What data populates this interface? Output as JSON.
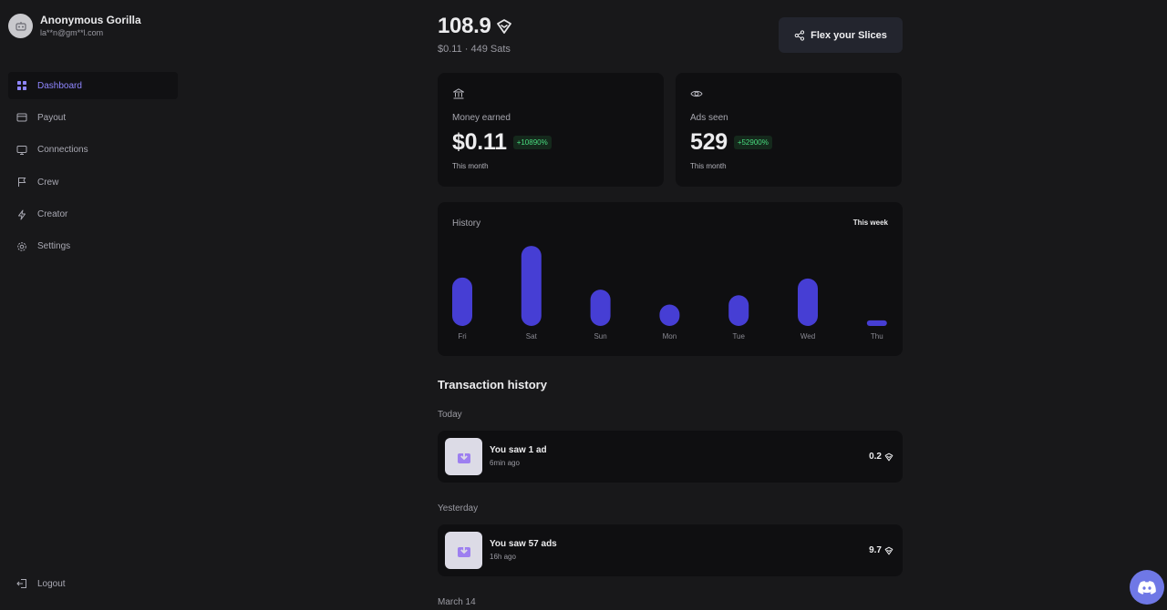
{
  "user": {
    "name": "Anonymous Gorilla",
    "email": "la**n@gm**l.com"
  },
  "nav": {
    "items": [
      {
        "label": "Dashboard",
        "icon": "grid-icon",
        "active": true
      },
      {
        "label": "Payout",
        "icon": "card-icon",
        "active": false
      },
      {
        "label": "Connections",
        "icon": "monitor-icon",
        "active": false
      },
      {
        "label": "Crew",
        "icon": "flag-icon",
        "active": false
      },
      {
        "label": "Creator",
        "icon": "bolt-icon",
        "active": false
      },
      {
        "label": "Settings",
        "icon": "gear-icon",
        "active": false
      }
    ],
    "logout_label": "Logout"
  },
  "balance": {
    "value": "108.9",
    "sub": "$0.11 · 449 Sats"
  },
  "flex_button_label": "Flex your Slices",
  "stats": {
    "money": {
      "title": "Money earned",
      "value": "$0.11",
      "badge": "+10890%",
      "period": "This month"
    },
    "ads": {
      "title": "Ads seen",
      "value": "529",
      "badge": "+52900%",
      "period": "This month"
    }
  },
  "history": {
    "title": "History",
    "period": "This week"
  },
  "chart_data": {
    "type": "bar",
    "categories": [
      "Fri",
      "Sat",
      "Sun",
      "Mon",
      "Tue",
      "Wed",
      "Thu"
    ],
    "values": [
      52,
      86,
      39,
      23,
      33,
      51,
      6
    ],
    "ylim": [
      0,
      90
    ],
    "bar_color": "#463ed4",
    "grid": false
  },
  "transactions": {
    "title": "Transaction history",
    "groups": [
      {
        "label": "Today",
        "items": [
          {
            "title": "You saw 1 ad",
            "time": "6min ago",
            "amount": "0.2"
          }
        ]
      },
      {
        "label": "Yesterday",
        "items": [
          {
            "title": "You saw 57 ads",
            "time": "16h ago",
            "amount": "9.7"
          }
        ]
      },
      {
        "label": "March 14",
        "items": []
      }
    ]
  },
  "colors": {
    "accent": "#8f86ff",
    "bar": "#463ed4",
    "positive": "#4ade80",
    "discord": "#6f78e6"
  }
}
